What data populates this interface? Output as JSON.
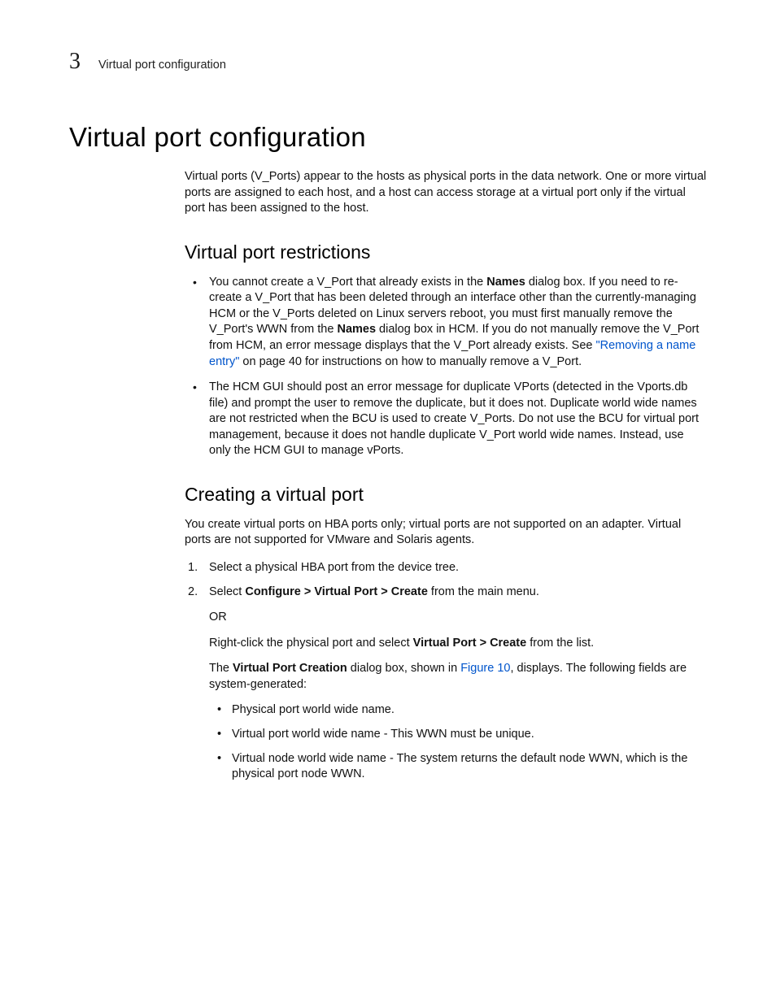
{
  "page_header": {
    "chapter_number": "3",
    "title": "Virtual port configuration"
  },
  "h1": "Virtual port configuration",
  "intro": "Virtual ports (V_Ports) appear to the hosts as physical ports in the data network. One or more virtual ports are assigned to each host, and a host can access storage at a virtual port only if the virtual port has been assigned to the host.",
  "section_restrictions": {
    "heading": "Virtual port restrictions",
    "bullet1": {
      "t1": "You cannot create a V_Port that already exists in the ",
      "b1": "Names",
      "t2": " dialog box. If you need to re-create a V_Port that has been deleted through an interface other than the currently-managing HCM or the V_Ports deleted on Linux servers reboot, you must first manually remove the V_Port's WWN from the ",
      "b2": "Names",
      "t3": " dialog box in HCM. If you do not manually remove the V_Port from HCM, an error message displays that the V_Port already exists. See ",
      "link": "\"Removing a name entry\"",
      "t4": " on page 40 for instructions on how to manually remove a V_Port."
    },
    "bullet2": "The HCM GUI should post an error message for duplicate VPorts (detected in the Vports.db file) and prompt the user to remove the duplicate, but it does not. Duplicate world wide names are not restricted when the BCU is used to create V_Ports. Do not use the BCU for virtual port management, because it does not handle duplicate V_Port world wide names. Instead, use only the HCM GUI to manage vPorts."
  },
  "section_creating": {
    "heading": "Creating a virtual port",
    "intro": "You create virtual ports on HBA ports only; virtual ports are not supported on an adapter. Virtual ports are not supported for VMware and Solaris agents.",
    "step1": "Select a physical HBA port from the device tree.",
    "step2": {
      "t1": "Select ",
      "b1": "Configure > Virtual Port > Create",
      "t2": " from the main menu.",
      "or": "OR",
      "alt_t1": "Right-click the physical port and select ",
      "alt_b1": "Virtual Port > Create",
      "alt_t2": " from the list.",
      "result_t1": "The ",
      "result_b1": "Virtual Port Creation",
      "result_t2": " dialog box, shown in ",
      "result_link": "Figure 10",
      "result_t3": ", displays. The following fields are system-generated:",
      "fields": [
        "Physical port world wide name.",
        "Virtual port world wide name - This WWN must be unique.",
        "Virtual node world wide name - The system returns the default node WWN, which is the physical port node WWN."
      ]
    }
  }
}
